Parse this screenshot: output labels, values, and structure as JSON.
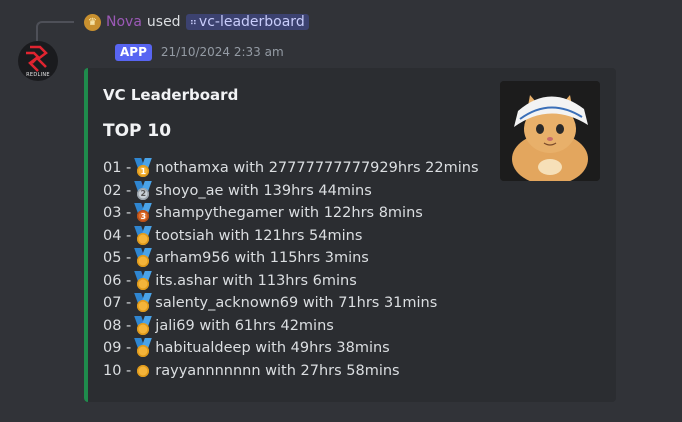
{
  "command": {
    "user": "Nova",
    "used_text": "used",
    "command_name": "vc-leaderboard"
  },
  "message": {
    "badge": "APP",
    "timestamp": "21/10/2024 2:33 am",
    "avatar_text": "REDLINE"
  },
  "embed": {
    "title": "VC Leaderboard",
    "heading": "TOP 10",
    "accent_color": "#1f8b4c",
    "rows": [
      {
        "rank": "01 -",
        "medal": "1",
        "text": "nothamxa with 27777777777929hrs 22mins"
      },
      {
        "rank": "02 -",
        "medal": "2",
        "text": "shoyo_ae with 139hrs 44mins"
      },
      {
        "rank": "03 -",
        "medal": "3",
        "text": "shampythegamer with 122hrs 8mins"
      },
      {
        "rank": "04 -",
        "medal": "",
        "text": "tootsiah with 121hrs 54mins"
      },
      {
        "rank": "05 -",
        "medal": "",
        "text": "arham956 with 115hrs 3mins"
      },
      {
        "rank": "06 -",
        "medal": "",
        "text": "its.ashar with 113hrs 6mins"
      },
      {
        "rank": "07 -",
        "medal": "",
        "text": "salenty_acknown69 with 71hrs 31mins"
      },
      {
        "rank": "08 -",
        "medal": "",
        "text": "jali69 with 61hrs 42mins"
      },
      {
        "rank": "09 -",
        "medal": "",
        "text": "habitualdeep with 49hrs 38mins"
      },
      {
        "rank": "10 -",
        "medal": "",
        "text": "rayyannnnnnn with 27hrs 58mins"
      }
    ]
  },
  "icons": {
    "user_avatar": "crown-avatar-icon",
    "command": "grid-command-icon",
    "bot_avatar": "redline-logo-icon",
    "thumbnail": "cat-image",
    "medal": "medal-icon"
  }
}
